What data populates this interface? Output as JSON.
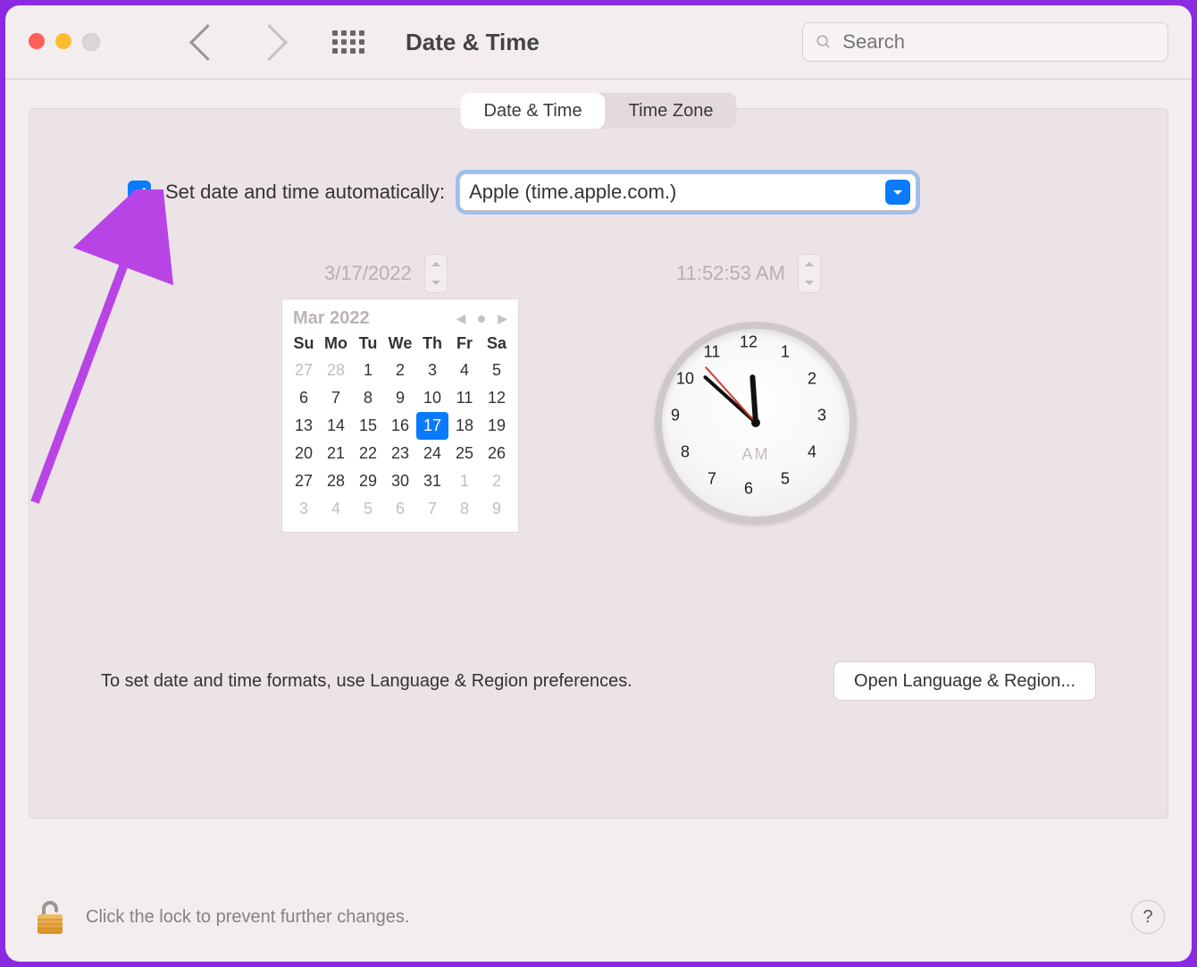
{
  "titlebar": {
    "title": "Date & Time",
    "search_placeholder": "Search"
  },
  "tabs": {
    "date_time": "Date & Time",
    "time_zone": "Time Zone"
  },
  "auto": {
    "label": "Set date and time automatically:",
    "checked": true,
    "server": "Apple (time.apple.com.)"
  },
  "date_field": "3/17/2022",
  "time_field": "11:52:53 AM",
  "calendar": {
    "title": "Mar 2022",
    "dows": [
      "Su",
      "Mo",
      "Tu",
      "We",
      "Th",
      "Fr",
      "Sa"
    ],
    "leading": [
      "27",
      "28"
    ],
    "days": [
      "1",
      "2",
      "3",
      "4",
      "5",
      "6",
      "7",
      "8",
      "9",
      "10",
      "11",
      "12",
      "13",
      "14",
      "15",
      "16",
      "17",
      "18",
      "19",
      "20",
      "21",
      "22",
      "23",
      "24",
      "25",
      "26",
      "27",
      "28",
      "29",
      "30",
      "31"
    ],
    "trailing": [
      "1",
      "2",
      "3",
      "4",
      "5",
      "6",
      "7",
      "8",
      "9"
    ],
    "selected": "17"
  },
  "clock": {
    "numbers": [
      "12",
      "1",
      "2",
      "3",
      "4",
      "5",
      "6",
      "7",
      "8",
      "9",
      "10",
      "11"
    ],
    "ampm": "AM",
    "hour_angle": 356,
    "minute_angle": 312,
    "second_angle": 318
  },
  "format_hint": "To set date and time formats, use Language & Region preferences.",
  "open_lang_region": "Open Language & Region...",
  "lock_hint": "Click the lock to prevent further changes.",
  "help": "?"
}
